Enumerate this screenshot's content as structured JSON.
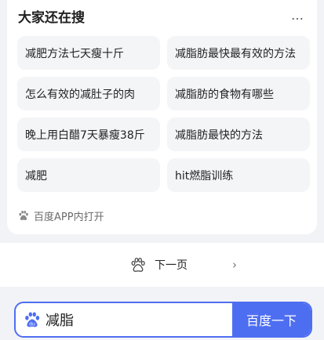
{
  "related": {
    "title": "大家还在搜",
    "more_icon": "…",
    "items": [
      "减肥方法七天瘦十斤",
      "减脂肪最快最有效的方法",
      "怎么有效的减肚子的肉",
      "减脂肪的食物有哪些",
      "晚上用白醋7天暴瘦38斤",
      "减脂肪最快的方法",
      "减肥",
      "hit燃脂训练"
    ],
    "open_app_label": "百度APP内打开"
  },
  "pagination": {
    "next_label": "下一页",
    "chevron": "›"
  },
  "search": {
    "value": "减脂",
    "button_label": "百度一下"
  },
  "colors": {
    "accent": "#4e6ef2",
    "chip_bg": "#f4f5f7",
    "page_bg": "#f2f3f6"
  }
}
